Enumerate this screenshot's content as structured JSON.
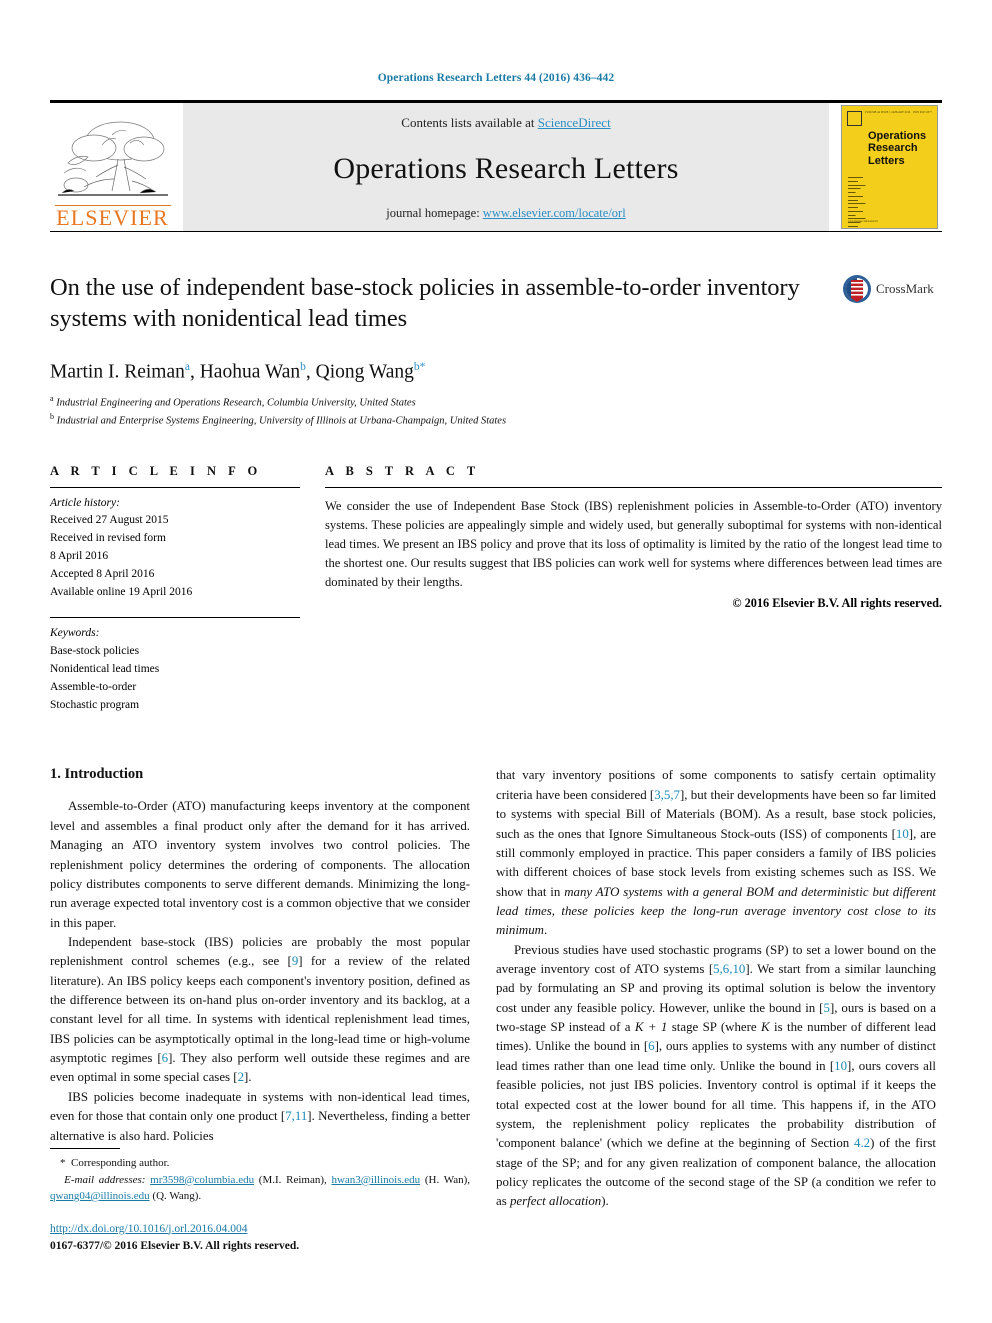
{
  "running_head": "Operations Research Letters 44 (2016) 436–442",
  "masthead": {
    "contents_prefix": "Contents lists available at ",
    "sciencedirect": "ScienceDirect",
    "journal_name": "Operations Research Letters",
    "homepage_prefix": "journal homepage: ",
    "homepage_url": "www.elsevier.com/locate/orl",
    "publisher": "ELSEVIER",
    "publisher_color": "#E87722",
    "accent_link_color": "#2b8fc4",
    "cover": {
      "title_line1": "Operations",
      "title_line2": "Research",
      "title_line3": "Letters",
      "background_color": "#F3CE1B",
      "masthead_micro": "VOLUME 44 ISSUE 1 JANUARY 2016",
      "issn_micro": "ISSN 0167-6377"
    }
  },
  "article": {
    "title": "On the use of independent base-stock policies in assemble-to-order inventory systems with nonidentical lead times",
    "crossmark_label": "CrossMark",
    "authors": [
      {
        "name": "Martin I. Reiman",
        "sup": "a"
      },
      {
        "name": "Haohua Wan",
        "sup": "b"
      },
      {
        "name": "Qiong Wang",
        "sup": "b",
        "star": "*"
      }
    ],
    "affiliations": [
      {
        "mark": "a",
        "text": "Industrial Engineering and Operations Research, Columbia University, United States"
      },
      {
        "mark": "b",
        "text": "Industrial and Enterprise Systems Engineering, University of Illinois at Urbana-Champaign, United States"
      }
    ]
  },
  "article_info": {
    "heading": "A R T I C L E   I N F O",
    "history_label": "Article history:",
    "history": [
      "Received 27 August 2015",
      "Received in revised form",
      "8 April 2016",
      "Accepted 8 April 2016",
      "Available online 19 April 2016"
    ],
    "keywords_label": "Keywords:",
    "keywords": [
      "Base-stock policies",
      "Nonidentical lead times",
      "Assemble-to-order",
      "Stochastic program"
    ]
  },
  "abstract": {
    "heading": "A B S T R A C T",
    "text": "We consider the use of Independent Base Stock (IBS) replenishment policies in Assemble-to-Order (ATO) inventory systems. These policies are appealingly simple and widely used, but generally suboptimal for systems with non-identical lead times. We present an IBS policy and prove that its loss of optimality is limited by the ratio of the longest lead time to the shortest one. Our results suggest that IBS policies can work well for systems where differences between lead times are dominated by their lengths.",
    "copyright": "© 2016 Elsevier B.V. All rights reserved."
  },
  "body": {
    "section_number_title": "1. Introduction",
    "left_paragraphs": [
      "Assemble-to-Order (ATO) manufacturing keeps inventory at the component level and assembles a final product only after the demand for it has arrived. Managing an ATO inventory system involves two control policies. The replenishment policy determines the ordering of components. The allocation policy distributes components to serve different demands. Minimizing the long-run average expected total inventory cost is a common objective that we consider in this paper."
    ],
    "left_para2_parts": {
      "a": "Independent base-stock (IBS) policies are probably the most popular replenishment control schemes (e.g., see [",
      "ref1": "9",
      "b": "] for a review of the related literature). An IBS policy keeps each component's inventory position, defined as the difference between its on-hand plus on-order inventory and its backlog, at a constant level for all time. In systems with identical replenishment lead times, IBS policies can be asymptotically optimal in the long-lead time or high-volume asymptotic regimes [",
      "ref2": "6",
      "c": "]. They also perform well outside these regimes and are even optimal in some special cases [",
      "ref3": "2",
      "d": "]."
    },
    "left_para3_parts": {
      "a": "IBS policies become inadequate in systems with non-identical lead times, even for those that contain only one product [",
      "ref1": "7,11",
      "b": "]. Nevertheless, finding a better alternative is also hard. Policies"
    },
    "right_para1_parts": {
      "a": "that vary inventory positions of some components to satisfy certain optimality criteria have been considered [",
      "ref1": "3,5,7",
      "b": "], but their developments have been so far limited to systems with special Bill of Materials (BOM). As a result, base stock policies, such as the ones that Ignore Simultaneous Stock-outs (ISS) of components [",
      "ref2": "10",
      "c": "], are still commonly employed in practice. This paper considers a family of IBS policies with different choices of base stock levels from existing schemes such as ISS. We show that in ",
      "italic1": "many ATO systems with a general BOM and deterministic but different lead times, these policies keep the long-run average inventory cost close to its minimum",
      "d": "."
    },
    "right_para2_parts": {
      "a": "Previous studies have used stochastic programs (SP) to set a lower bound on the average inventory cost of ATO systems [",
      "ref1": "5,6,10",
      "b": "]. We start from a similar launching pad by formulating an SP and proving its optimal solution is below the inventory cost under any feasible policy. However, unlike the bound in [",
      "ref2": "5",
      "c": "], ours is based on a two-stage SP instead of a ",
      "math1": "K + 1",
      "d": " stage SP (where ",
      "math2": "K",
      "e": " is the number of different lead times). Unlike the bound in [",
      "ref3": "6",
      "f": "], ours applies to systems with any number of distinct lead times rather than one lead time only. Unlike the bound in [",
      "ref4": "10",
      "g": "], ours covers all feasible policies, not just IBS policies. Inventory control is optimal if it keeps the total expected cost at the lower bound for all time. This happens if, in the ATO system, the replenishment policy replicates the probability distribution of 'component balance' (which we define at the beginning of Section ",
      "ref5": "4.2",
      "h": ") of the first stage of the SP; and for any given realization of component balance, the allocation policy replicates the outcome of the second stage of the SP (a condition we refer to as ",
      "italic1": "perfect allocation",
      "i": ")."
    }
  },
  "footnotes": {
    "corresponding_star": "*",
    "corresponding_text": "Corresponding author.",
    "email_label": "E-mail addresses:",
    "emails": [
      {
        "address": "mr3598@columbia.edu",
        "owner": "(M.I. Reiman)"
      },
      {
        "address": "hwan3@illinois.edu",
        "owner": "(H. Wan)"
      },
      {
        "address": "qwang04@illinois.edu",
        "owner": "(Q. Wang)"
      }
    ],
    "doi": "http://dx.doi.org/10.1016/j.orl.2016.04.004",
    "issn_line": "0167-6377/© 2016 Elsevier B.V. All rights reserved."
  }
}
